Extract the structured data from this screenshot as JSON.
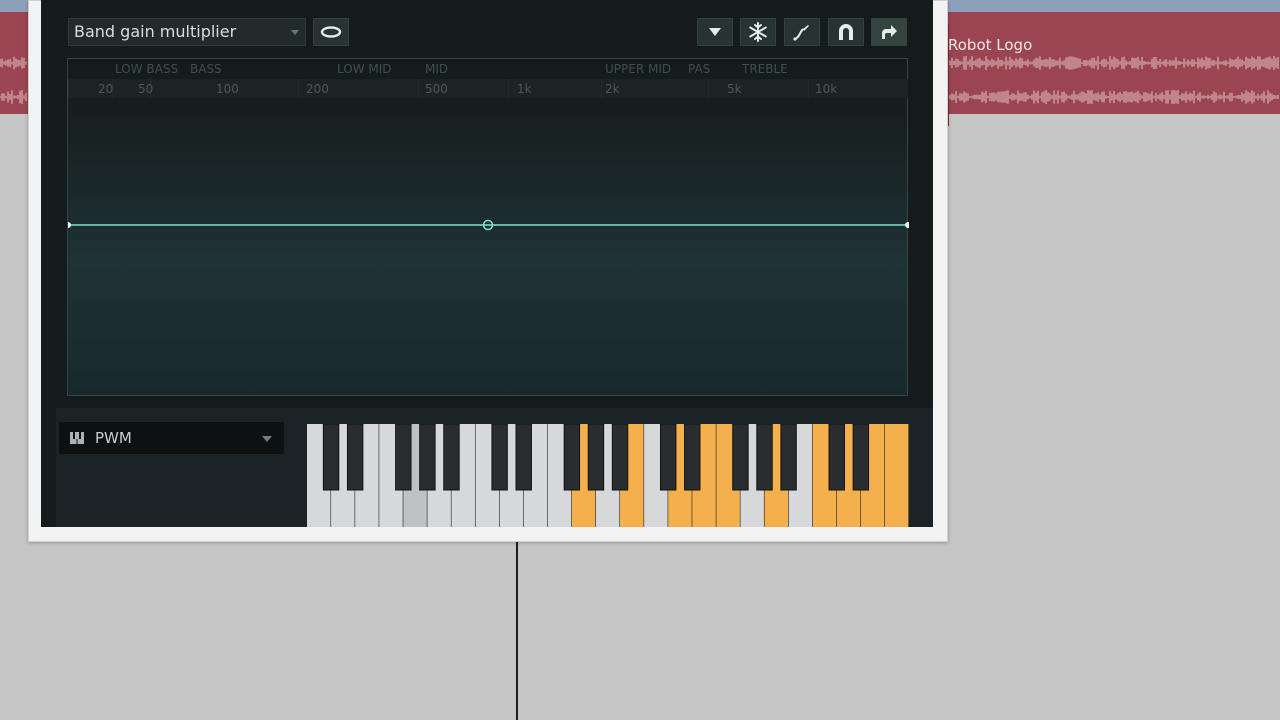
{
  "playlist": {
    "clip_name": "Robot Logo",
    "track_color": "#9b4552"
  },
  "plugin": {
    "preset": "Band gain multiplier",
    "toolbar_icons": [
      "loop-icon",
      "dropdown-icon",
      "snowflake-icon",
      "curve-tool-icon",
      "magnet-icon",
      "arrow-right-icon"
    ],
    "bands": [
      {
        "label": "LOW BASS"
      },
      {
        "label": "BASS"
      },
      {
        "label": "LOW MID"
      },
      {
        "label": "MID"
      },
      {
        "label": "UPPER MID"
      },
      {
        "label": "PAS"
      },
      {
        "label": "TREBLE"
      }
    ],
    "frequencies": [
      "20",
      "50",
      "100",
      "200",
      "500",
      "1k",
      "2k",
      "5k",
      "10k"
    ],
    "waveform": "PWM",
    "accent_color": "#7de3cf",
    "highlight_key_color": "#f4b04c"
  }
}
